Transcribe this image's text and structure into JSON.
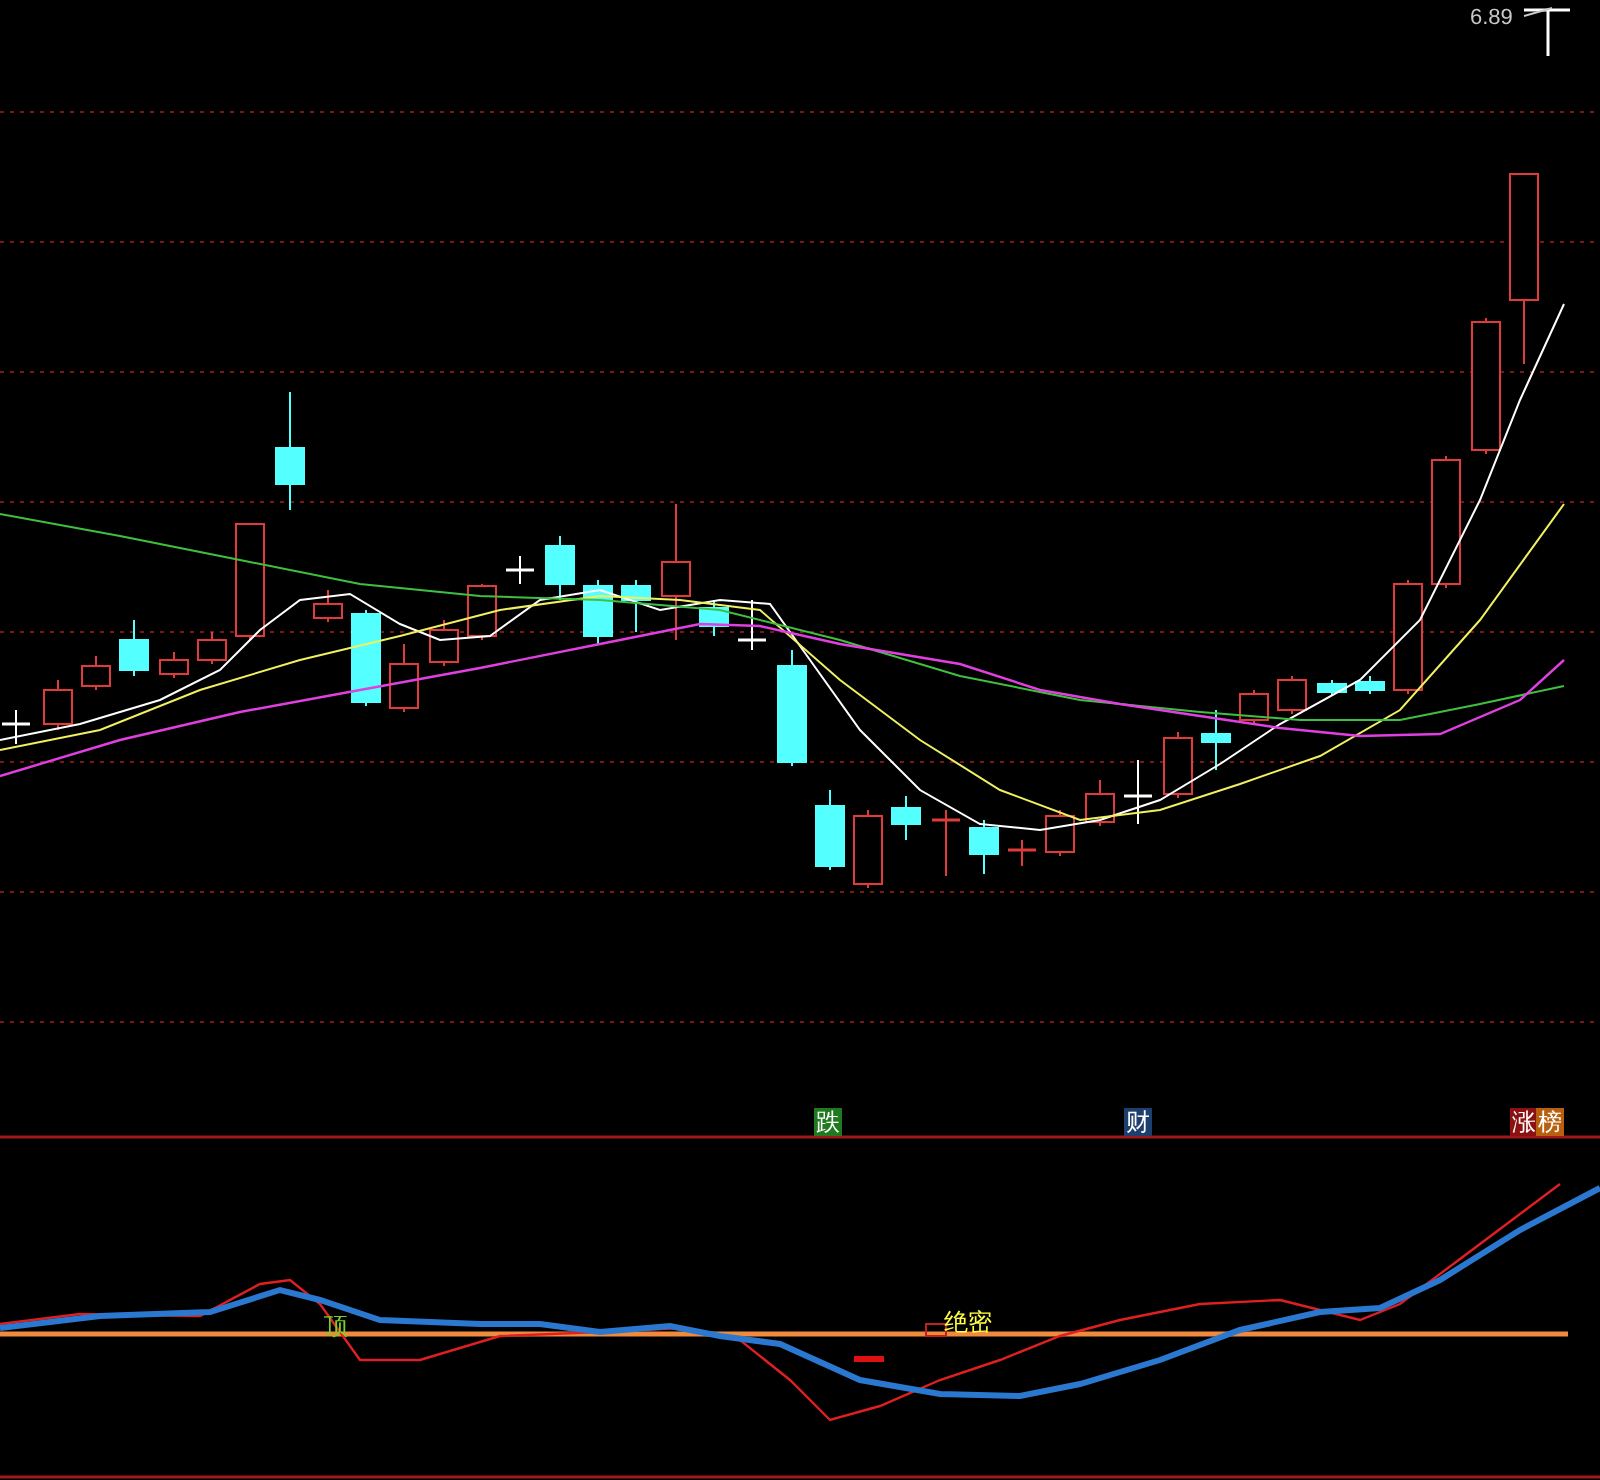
{
  "price_chart": {
    "high_label": "6.89",
    "signals": [
      {
        "text": "跌",
        "color": "#1f7a1f"
      },
      {
        "text": "财",
        "color": "#1d3f6e"
      },
      {
        "text": "涨",
        "color": "#8c1212"
      },
      {
        "text": "榜",
        "color": "#b8600f"
      }
    ]
  },
  "indicator": {
    "markers": [
      {
        "text": "顶",
        "color": "#7ccf2a"
      },
      {
        "text": "绝密",
        "color": "#ffff44"
      }
    ]
  }
}
